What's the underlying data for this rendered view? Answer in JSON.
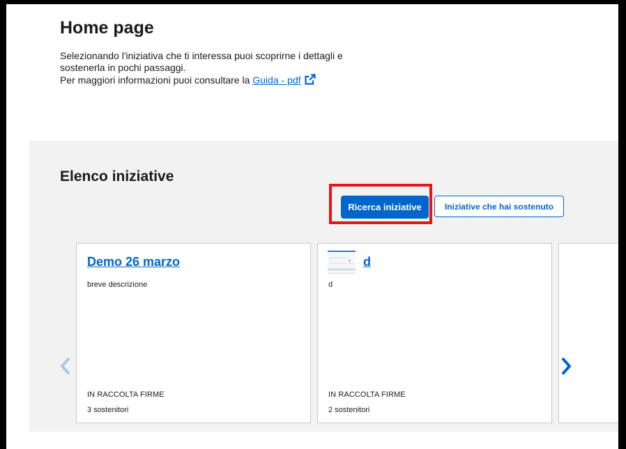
{
  "header": {
    "title": "Home page",
    "intro_line1": "Selezionando l'iniziativa che ti interessa puoi scoprirne i dettagli e",
    "intro_line2": "sostenerla in pochi passaggi.",
    "intro_line3_prefix": "Per maggiori informazioni puoi consultare la",
    "guide_link_label": "Guida - pdf",
    "guide_link_icon": "external-link-icon"
  },
  "initiatives": {
    "title": "Elenco iniziative",
    "search_button_label": "Ricerca iniziative",
    "supported_button_label": "Iniziative che hai sostenuto",
    "cards": [
      {
        "title": "Demo 26 marzo",
        "description": "breve descrizione",
        "status": "IN RACCOLTA FIRME",
        "supporters": "3 sostenitori"
      },
      {
        "title": "d",
        "description": "d",
        "status": "IN RACCOLTA FIRME",
        "supporters": "2 sostenitori",
        "thumbnail": "image-thumbnail-icon"
      }
    ],
    "prev_icon": "chevron-left-icon",
    "next_icon": "chevron-right-icon"
  },
  "colors": {
    "accent": "#0066cc",
    "highlight": "#e8141b",
    "section_background": "#f2f2f2",
    "prev_disabled": "#a9c8ea"
  }
}
